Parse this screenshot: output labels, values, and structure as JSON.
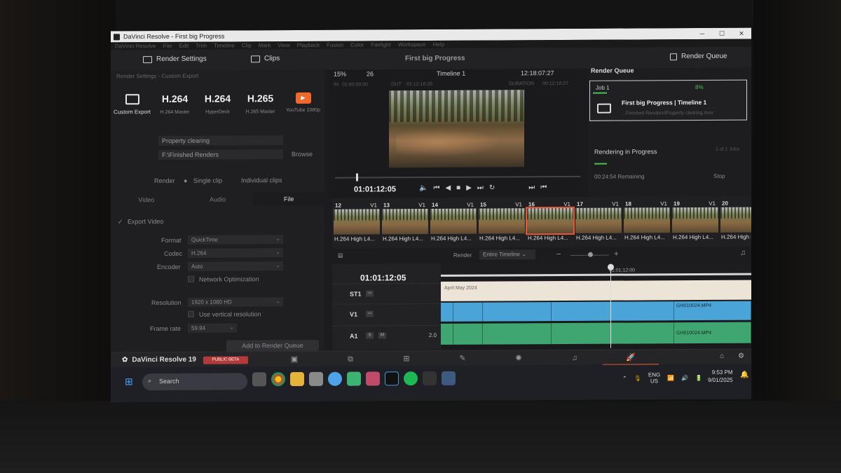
{
  "window": {
    "title": "DaVinci Resolve - First big Progress",
    "controls": [
      "─",
      "☐",
      "✕"
    ],
    "menu": [
      "DaVinci Resolve",
      "File",
      "Edit",
      "Trim",
      "Timeline",
      "Clip",
      "Mark",
      "View",
      "Playback",
      "Fusion",
      "Color",
      "Fairlight",
      "Workspace",
      "Help"
    ]
  },
  "toolbar": {
    "render_settings_label": "Render Settings",
    "clips_label": "Clips",
    "project_name": "First big Progress",
    "render_queue_label": "Render Queue"
  },
  "render_settings": {
    "header": "Render Settings - Custom Export",
    "presets": [
      {
        "title": "",
        "sub": "Custom Export"
      },
      {
        "title": "H.264",
        "sub": "H.264 Master"
      },
      {
        "title": "H.264",
        "sub": "HyperDeck"
      },
      {
        "title": "H.265",
        "sub": "H.265 Master"
      },
      {
        "title": "",
        "sub": "YouTube 1080p"
      }
    ],
    "filename": "Property clearing",
    "location": "F:\\Finished Renders",
    "browse_label": "Browse",
    "render_label": "Render",
    "single_clip_label": "Single clip",
    "individual_clips_label": "Individual clips",
    "tabs": [
      "Video",
      "Audio",
      "File"
    ],
    "export_video_label": "Export Video",
    "format_label": "Format",
    "format_value": "QuickTime",
    "codec_label": "Codec",
    "codec_value": "H.264",
    "encoder_label": "Encoder",
    "encoder_value": "Auto",
    "network_opt_label": "Network Optimization",
    "resolution_label": "Resolution",
    "resolution_value": "1920 x 1080 HD",
    "vertical_label": "Use vertical resolution",
    "framerate_label": "Frame rate",
    "framerate_value": "59.94",
    "add_button": "Add to Render Queue"
  },
  "viewer": {
    "zoom": "15%",
    "fps": "26",
    "timeline_name": "Timeline 1",
    "timecode_top": "12:18:07:27",
    "in_label": "IN",
    "in_value": "01:00:00:00",
    "out_label": "OUT",
    "out_value": "01:12:18:26",
    "duration_label": "DURATION",
    "duration_value": "00:12:18:27",
    "current_timecode": "01:01:12:05"
  },
  "render_queue": {
    "title": "Render Queue",
    "job_name": "Job 1",
    "job_percent": "8%",
    "job_title": "First big Progress | Timeline 1",
    "job_path": "...Finished Renders\\Property clearing.mov",
    "status": "Rendering in Progress",
    "job_count": "1 of 1 Jobs",
    "remaining": "00:24:54 Remaining",
    "stop_label": "Stop"
  },
  "clips": [
    {
      "num": "12",
      "track": "V1",
      "caption": "H.264 High L4..."
    },
    {
      "num": "13",
      "track": "V1",
      "caption": "H.264 High L4..."
    },
    {
      "num": "14",
      "track": "V1",
      "caption": "H.264 High L4..."
    },
    {
      "num": "15",
      "track": "V1",
      "caption": "H.264 High L4..."
    },
    {
      "num": "16",
      "track": "V1",
      "caption": "H.264 High L4..."
    },
    {
      "num": "17",
      "track": "V1",
      "caption": "H.264 High L4..."
    },
    {
      "num": "18",
      "track": "V1",
      "caption": "H.264 High L4..."
    },
    {
      "num": "19",
      "track": "V1",
      "caption": "H.264 High L4..."
    },
    {
      "num": "20",
      "track": "V1",
      "caption": "H.264 High L4..."
    }
  ],
  "timeline": {
    "render_label": "Render",
    "range_value": "Entire Timeline",
    "minus": "−",
    "plus": "+",
    "timecode": "01:01:12:05",
    "ruler_tc": "01:01:12:00",
    "subtitle_text": "April   May 2024",
    "tracks": [
      {
        "name": "ST1"
      },
      {
        "name": "V1"
      },
      {
        "name": "A1",
        "level": "2.0"
      }
    ],
    "v_clip": "GH010024.MP4",
    "a_clip": "GH010024.MP4",
    "s_button": "S",
    "m_button": "M"
  },
  "pagenav": {
    "app_name": "DaVinci Resolve 19",
    "beta": "PUBLIC BETA",
    "active_page": "deliver"
  },
  "taskbar": {
    "search_label": "Search",
    "lang": "ENG",
    "region": "US",
    "time": "9:53 PM",
    "date": "9/01/2025"
  },
  "colors": {
    "accent": "#e4593c",
    "progress": "#46c24f",
    "video_track": "#4aa4d8",
    "audio_track": "#3fa671"
  }
}
